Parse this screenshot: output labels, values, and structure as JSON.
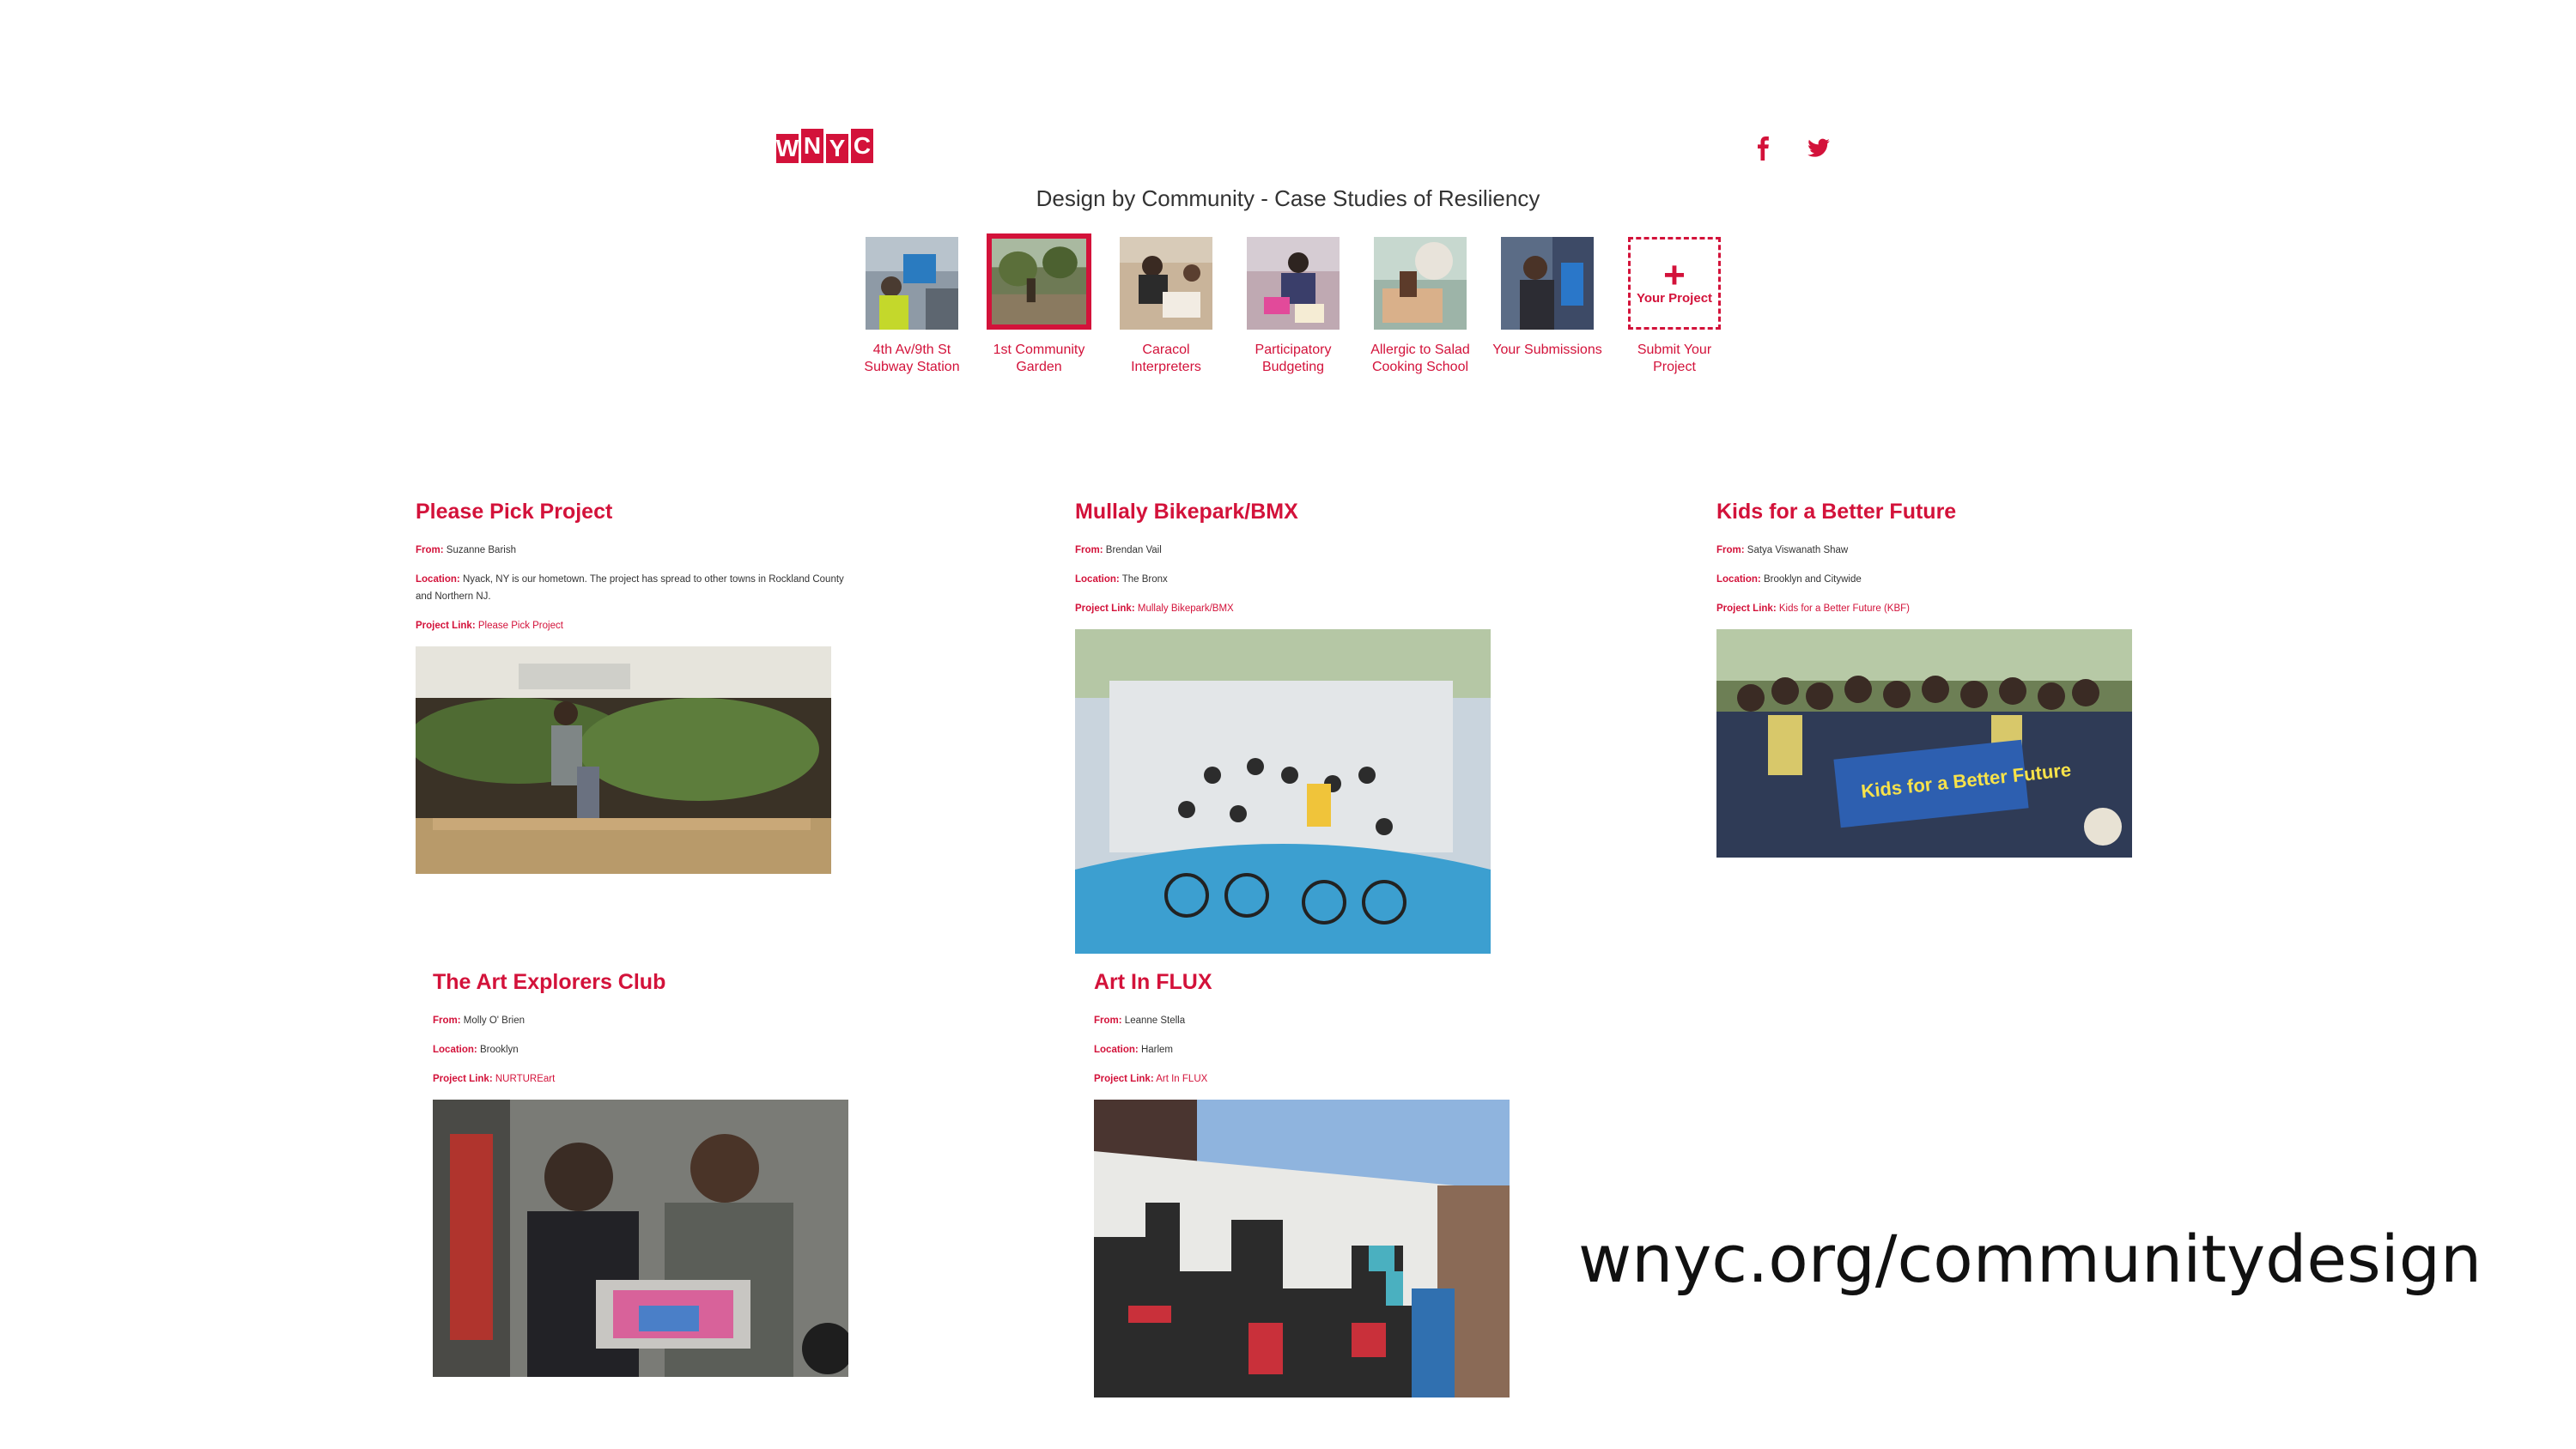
{
  "header": {
    "logo_letters": [
      "W",
      "N",
      "Y",
      "C"
    ],
    "title": "Design by Community - Case Studies of Resiliency",
    "social": [
      "facebook-icon",
      "twitter-icon"
    ]
  },
  "nav": [
    {
      "label": "4th Av/9th St Subway Station",
      "active": false
    },
    {
      "label": "1st Community Garden",
      "active": true
    },
    {
      "label": "Caracol Interpreters",
      "active": false
    },
    {
      "label": "Participatory Budgeting",
      "active": false
    },
    {
      "label": "Allergic to Salad Cooking School",
      "active": false
    },
    {
      "label": "Your Submissions",
      "active": false
    },
    {
      "label": "Submit Your Project",
      "active": false,
      "tile_text": "Your Project"
    }
  ],
  "projects": [
    {
      "title": "Please Pick Project",
      "from": "Suzanne Barish",
      "location": "Nyack, NY is our hometown. The project has spread to other towns in Rockland County and Northern NJ.",
      "link": "Please Pick Project"
    },
    {
      "title": "Mullaly Bikepark/BMX",
      "from": "Brendan Vail",
      "location": "The Bronx",
      "link": "Mullaly Bikepark/BMX"
    },
    {
      "title": "Kids for a Better Future",
      "from": "Satya Viswanath Shaw",
      "location": "Brooklyn and Citywide",
      "link": "Kids for a Better Future (KBF)"
    },
    {
      "title": "The Art Explorers Club",
      "from": "Molly O' Brien",
      "location": "Brooklyn",
      "link": "NURTUREart"
    },
    {
      "title": "Art In FLUX",
      "from": "Leanne Stella",
      "location": "Harlem",
      "link": "Art In FLUX"
    }
  ],
  "labels": {
    "from": "From:",
    "location": "Location:",
    "link": "Project Link:"
  },
  "banner_text": "Kids for a Better Future",
  "url_caption": "wnyc.org/communitydesign",
  "colors": {
    "accent": "#d3123a",
    "text": "#333333",
    "background": "#ffffff"
  }
}
